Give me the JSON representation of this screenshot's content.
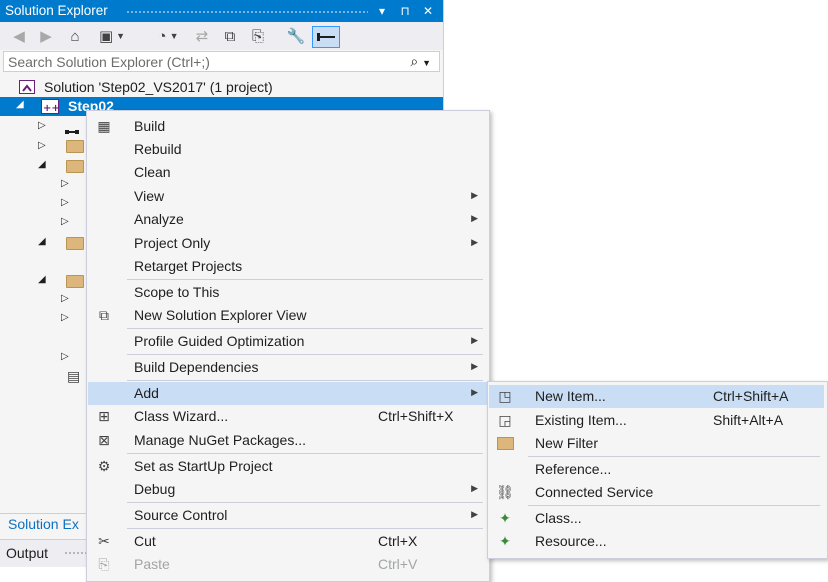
{
  "window": {
    "title": "Solution Explorer",
    "title_buttons": [
      "▾",
      "⊓",
      "✕"
    ]
  },
  "search": {
    "placeholder": "Search Solution Explorer (Ctrl+;)"
  },
  "tree": {
    "solution_label": "Solution 'Step02_VS2017' (1 project)",
    "project_label": "Step02"
  },
  "bottom_tabs": {
    "solution_explorer": "Solution Ex",
    "output": "Output"
  },
  "context_menu": {
    "items": [
      {
        "label": "Build",
        "icon": "build-icon"
      },
      {
        "label": "Rebuild"
      },
      {
        "label": "Clean"
      },
      {
        "label": "View",
        "submenu": true
      },
      {
        "label": "Analyze",
        "submenu": true
      },
      {
        "label": "Project Only",
        "submenu": true
      },
      {
        "label": "Retarget Projects"
      },
      {
        "label": "Scope to This"
      },
      {
        "label": "New Solution Explorer View",
        "icon": "new-view-icon"
      },
      {
        "label": "Profile Guided Optimization",
        "submenu": true
      },
      {
        "label": "Build Dependencies",
        "submenu": true
      },
      {
        "label": "Add",
        "submenu": true,
        "highlighted": true
      },
      {
        "label": "Class Wizard...",
        "shortcut": "Ctrl+Shift+X",
        "icon": "class-wizard-icon"
      },
      {
        "label": "Manage NuGet Packages...",
        "icon": "nuget-icon"
      },
      {
        "label": "Set as StartUp Project",
        "icon": "gear-icon"
      },
      {
        "label": "Debug",
        "submenu": true
      },
      {
        "label": "Source Control",
        "submenu": true
      },
      {
        "label": "Cut",
        "shortcut": "Ctrl+X",
        "icon": "scissors-icon"
      },
      {
        "label": "Paste",
        "shortcut": "Ctrl+V",
        "disabled": true
      }
    ]
  },
  "add_submenu": {
    "items": [
      {
        "label": "New Item...",
        "shortcut": "Ctrl+Shift+A",
        "icon": "new-item-icon",
        "highlighted": true
      },
      {
        "label": "Existing Item...",
        "shortcut": "Shift+Alt+A",
        "icon": "existing-item-icon"
      },
      {
        "label": "New Filter",
        "icon": "folder-icon"
      },
      {
        "label": "Reference..."
      },
      {
        "label": "Connected Service",
        "icon": "connected-service-icon"
      },
      {
        "label": "Class...",
        "icon": "class-icon"
      },
      {
        "label": "Resource...",
        "icon": "resource-icon"
      }
    ]
  },
  "colors": {
    "accent": "#007acc",
    "menu_background": "#f5f5f5",
    "menu_highlight": "#c9def5"
  }
}
